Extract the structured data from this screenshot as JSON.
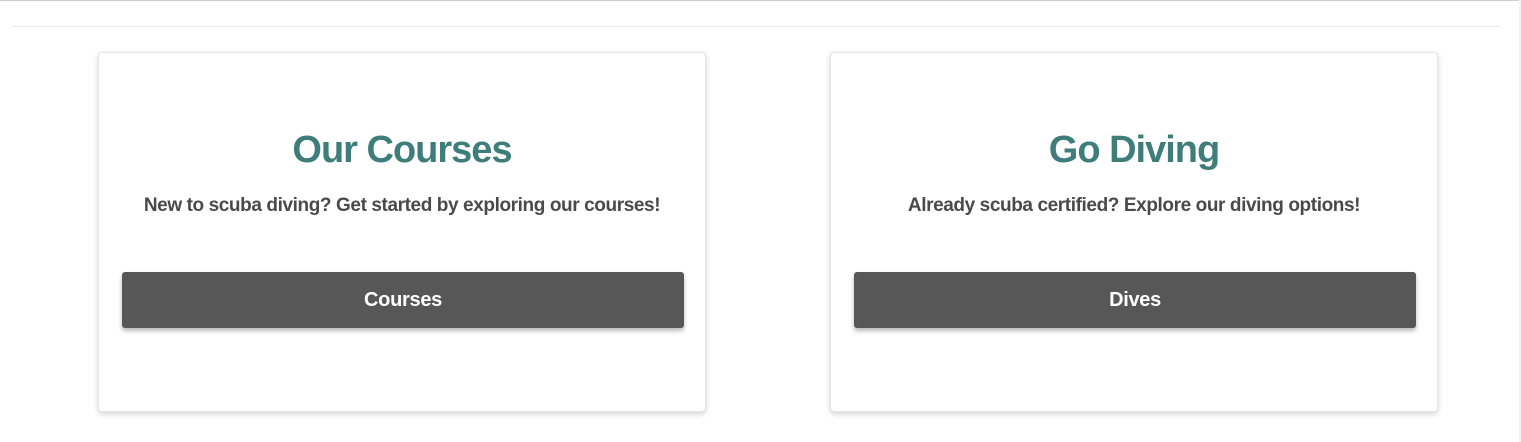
{
  "cards": [
    {
      "title": "Our Courses",
      "text": "New to scuba diving? Get started by exploring our courses!",
      "button_label": "Courses"
    },
    {
      "title": "Go Diving",
      "text": "Already scuba certified? Explore our diving options!",
      "button_label": "Dives"
    }
  ],
  "colors": {
    "title": "#3f7d7a",
    "text": "#4a4a4a",
    "button_bg": "#575757",
    "button_text": "#ffffff"
  }
}
